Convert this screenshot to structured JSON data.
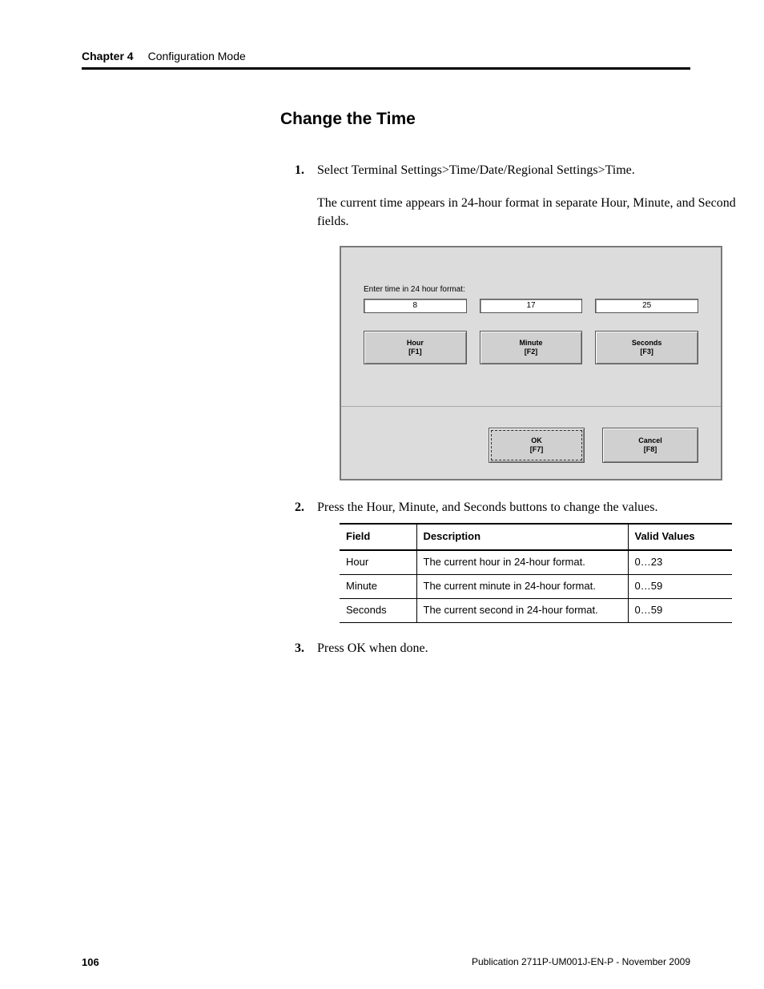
{
  "header": {
    "chapter_label": "Chapter 4",
    "chapter_title": "Configuration Mode"
  },
  "section_title": "Change the Time",
  "steps": {
    "s1": {
      "text": "Select Terminal Settings>Time/Date/Regional Settings>Time.",
      "para": "The current time appears in 24-hour format in separate Hour, Minute, and Second fields."
    },
    "s2": {
      "text": "Press the Hour, Minute, and Seconds buttons to change the values."
    },
    "s3": {
      "text": "Press OK when done."
    }
  },
  "ui": {
    "prompt": "Enter time in 24 hour format:",
    "hour_value": "8",
    "minute_value": "17",
    "second_value": "25",
    "hour_btn_l1": "Hour",
    "hour_btn_l2": "[F1]",
    "minute_btn_l1": "Minute",
    "minute_btn_l2": "[F2]",
    "second_btn_l1": "Seconds",
    "second_btn_l2": "[F3]",
    "ok_l1": "OK",
    "ok_l2": "[F7]",
    "cancel_l1": "Cancel",
    "cancel_l2": "[F8]"
  },
  "table": {
    "headers": {
      "field": "Field",
      "desc": "Description",
      "valid": "Valid Values"
    },
    "rows": [
      {
        "field": "Hour",
        "desc": "The current hour in 24-hour format.",
        "valid": "0…23"
      },
      {
        "field": "Minute",
        "desc": "The current minute in 24-hour format.",
        "valid": "0…59"
      },
      {
        "field": "Seconds",
        "desc": "The current second in 24-hour format.",
        "valid": "0…59"
      }
    ]
  },
  "footer": {
    "page": "106",
    "pub": "Publication 2711P-UM001J-EN-P - November 2009"
  }
}
